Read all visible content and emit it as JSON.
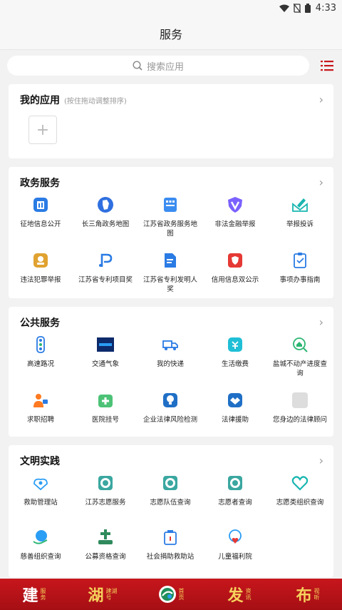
{
  "status": {
    "time": "4:33"
  },
  "header": {
    "title": "服务"
  },
  "search": {
    "placeholder": "搜索应用"
  },
  "my_apps": {
    "title": "我的应用",
    "hint": "(按住拖动调整排序)",
    "add": "+"
  },
  "sections": [
    {
      "title": "政务服务",
      "items": [
        {
          "label": "征地信息公开",
          "icon": "info-board-icon",
          "color": "#2a7be4"
        },
        {
          "label": "长三角政务地图",
          "icon": "map-region-icon",
          "color": "#2f6fe0"
        },
        {
          "label": "江苏省政务服务地图",
          "icon": "calendar-grid-icon",
          "color": "#3b8df0"
        },
        {
          "label": "非法金融举报",
          "icon": "shield-v-icon",
          "color": "#7b61ff"
        },
        {
          "label": "举报投诉",
          "icon": "envelope-pen-icon",
          "color": "#19b6b0"
        },
        {
          "label": "违法犯罪举报",
          "icon": "badge-icon",
          "color": "#e0a230"
        },
        {
          "label": "江苏省专利项目奖",
          "icon": "patent-p-icon",
          "color": "#2a7be4"
        },
        {
          "label": "江苏省专利发明人奖",
          "icon": "document-person-icon",
          "color": "#2a7be4"
        },
        {
          "label": "信用信息双公示",
          "icon": "credit-shield-icon",
          "color": "#e53935"
        },
        {
          "label": "事项办事指南",
          "icon": "clipboard-check-icon",
          "color": "#2a7be4"
        }
      ]
    },
    {
      "title": "公共服务",
      "items": [
        {
          "label": "高速路况",
          "icon": "traffic-light-icon",
          "color": "#2a7be4"
        },
        {
          "label": "交通气象",
          "icon": "weather-banner-icon",
          "color": "#0d2a6b"
        },
        {
          "label": "我的快递",
          "icon": "delivery-truck-icon",
          "color": "#2a7be4"
        },
        {
          "label": "生活缴费",
          "icon": "bill-pay-icon",
          "color": "#1fbfd6"
        },
        {
          "label": "盐城不动产进度查询",
          "icon": "house-search-icon",
          "color": "#2bb673"
        },
        {
          "label": "求职招聘",
          "icon": "job-person-icon",
          "color": "#ff7a21"
        },
        {
          "label": "医院挂号",
          "icon": "hospital-plus-icon",
          "color": "#4cc276"
        },
        {
          "label": "企业法律风险检测",
          "icon": "bulb-icon",
          "color": "#1f6fc6"
        },
        {
          "label": "法律援助",
          "icon": "handshake-icon",
          "color": "#1f6fc6"
        },
        {
          "label": "您身边的法律顾问",
          "icon": "placeholder-icon",
          "color": "#dddddd"
        }
      ]
    },
    {
      "title": "文明实践",
      "items": [
        {
          "label": "救助管理站",
          "icon": "helping-hands-icon",
          "color": "#2a9df4"
        },
        {
          "label": "江苏志愿服务",
          "icon": "volunteer-emblem-icon",
          "color": "#3aa7a0"
        },
        {
          "label": "志愿队伍查询",
          "icon": "volunteer-emblem-icon",
          "color": "#3aa7a0"
        },
        {
          "label": "志愿者查询",
          "icon": "volunteer-emblem-icon",
          "color": "#3aa7a0"
        },
        {
          "label": "志愿类组织查询",
          "icon": "heart-hands-icon",
          "color": "#19b6b0"
        },
        {
          "label": "慈善组织查询",
          "icon": "globe-hand-icon",
          "color": "#2a9df4"
        },
        {
          "label": "公募资格查询",
          "icon": "donation-cross-icon",
          "color": "#2f8a5c"
        },
        {
          "label": "社会捐助救助站",
          "icon": "donation-box-icon",
          "color": "#2a7be4"
        },
        {
          "label": "儿童福利院",
          "icon": "child-heart-icon",
          "color": "#2a9df4"
        }
      ]
    }
  ],
  "tabbar": [
    {
      "big": "建",
      "small1": "服",
      "small2": "务",
      "gold": false
    },
    {
      "big": "湖",
      "small1": "建湖",
      "small2": "号",
      "gold": true
    },
    {
      "big": "",
      "small1": "首",
      "small2": "页",
      "gold": false,
      "logo": true
    },
    {
      "big": "发",
      "small1": "资",
      "small2": "讯",
      "gold": true
    },
    {
      "big": "布",
      "small1": "视",
      "small2": "听",
      "gold": true
    }
  ]
}
